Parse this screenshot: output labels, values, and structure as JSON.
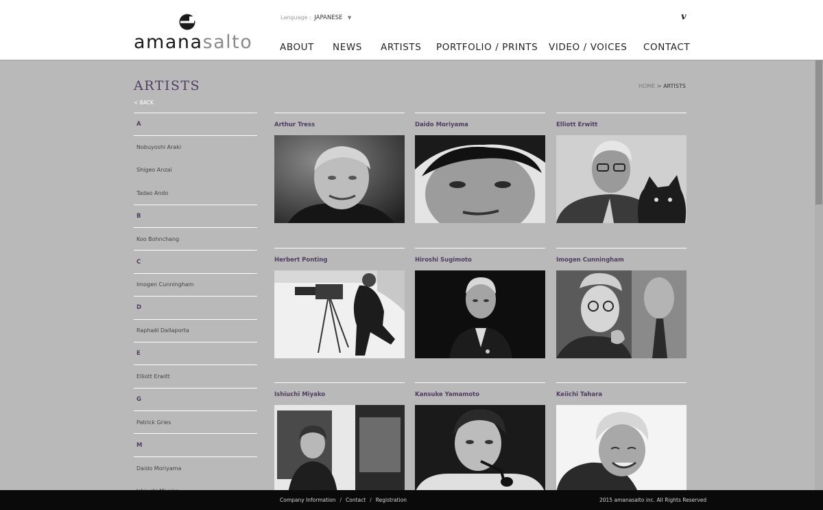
{
  "brand": {
    "name_part1": "amana",
    "name_part2": "salto"
  },
  "header": {
    "language_label": "Language :",
    "language_value": "JAPANESE",
    "social_icon": "v"
  },
  "nav": [
    {
      "label": "ABOUT"
    },
    {
      "label": "NEWS"
    },
    {
      "label": "ARTISTS"
    },
    {
      "label": "PORTFOLIO / PRINTS"
    },
    {
      "label": "VIDEO / VOICES"
    },
    {
      "label": "CONTACT"
    }
  ],
  "page": {
    "title": "ARTISTS",
    "back": "< BACK"
  },
  "breadcrumb": {
    "home": "HOME",
    "sep": ">",
    "current": "ARTISTS"
  },
  "sidebar": [
    {
      "type": "letter",
      "text": "A"
    },
    {
      "type": "name",
      "text": "Nobuyoshi Araki"
    },
    {
      "type": "name",
      "text": "Shigeo Anzai"
    },
    {
      "type": "name",
      "text": "Tadao Ando"
    },
    {
      "type": "letter",
      "text": "B"
    },
    {
      "type": "name",
      "text": "Koo Bohnchang"
    },
    {
      "type": "letter",
      "text": "C"
    },
    {
      "type": "name",
      "text": "Imogen Cunningham"
    },
    {
      "type": "letter",
      "text": "D"
    },
    {
      "type": "name",
      "text": "Raphaël Dallaporta"
    },
    {
      "type": "letter",
      "text": "E"
    },
    {
      "type": "name",
      "text": "Elliott Erwitt"
    },
    {
      "type": "letter",
      "text": "G"
    },
    {
      "type": "name",
      "text": "Patrick Gries"
    },
    {
      "type": "letter",
      "text": "M"
    },
    {
      "type": "name",
      "text": "Daido Moriyama"
    },
    {
      "type": "name",
      "text": "Ishiuchi Miyako"
    }
  ],
  "artists": [
    {
      "name": "Arthur Tress",
      "photo": "portrait-smiling-man"
    },
    {
      "name": "Daido Moriyama",
      "photo": "portrait-closeup-face"
    },
    {
      "name": "Elliott Erwitt",
      "photo": "portrait-man-with-dog"
    },
    {
      "name": "Herbert Ponting",
      "photo": "photographer-with-camera-in-snow"
    },
    {
      "name": "Hiroshi Sugimoto",
      "photo": "portrait-dark-background"
    },
    {
      "name": "Imogen Cunningham",
      "photo": "portrait-elderly-woman"
    },
    {
      "name": "Ishiuchi Miyako",
      "photo": "portrait-woman-in-gallery"
    },
    {
      "name": "Kansuke Yamamoto",
      "photo": "portrait-man-with-pipe"
    },
    {
      "name": "Keiichi Tahara",
      "photo": "portrait-laughing-man"
    }
  ],
  "footer": {
    "links": [
      "Company Information",
      "Contact",
      "Registration"
    ],
    "copyright": "2015 amanasalto inc. All Rights Reserved"
  },
  "colors": {
    "accent": "#4e3d60",
    "background": "#b9b9b9",
    "header": "#ffffff",
    "footer": "#0a0a0a"
  }
}
